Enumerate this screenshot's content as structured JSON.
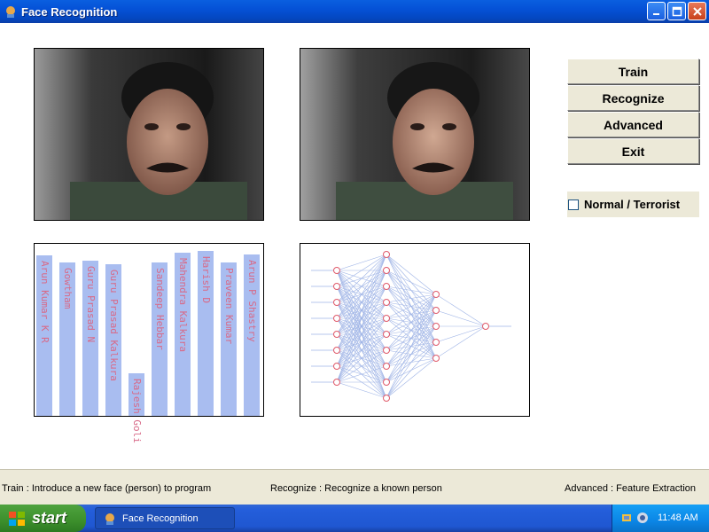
{
  "window": {
    "title": "Face Recognition"
  },
  "buttons": {
    "train": "Train",
    "recognize": "Recognize",
    "advanced": "Advanced",
    "exit": "Exit"
  },
  "checkbox": {
    "label": "Normal / Terrorist",
    "checked": false
  },
  "chart_data": {
    "type": "bar",
    "categories": [
      "Arun Kumar K R",
      "Gowtham",
      "Guru Prasad N",
      "Guru Prasad Kalkura",
      "Rajesh Goli",
      "Sandeep Hebbar",
      "Mahendra Kalkura",
      "Harish D",
      "Praveen Kumar",
      "Arun P Shastry"
    ],
    "values": [
      0.95,
      0.91,
      0.92,
      0.9,
      0.25,
      0.91,
      0.97,
      0.98,
      0.91,
      0.96
    ],
    "ylim": [
      0,
      1
    ]
  },
  "network": {
    "layers": [
      8,
      10,
      5,
      1
    ]
  },
  "status": {
    "train_help": "Train : Introduce a new face (person) to program",
    "recognize_help": "Recognize : Recognize a known person",
    "advanced_help": "Advanced : Feature Extraction"
  },
  "taskbar": {
    "start_label": "start",
    "task_title": "Face Recognition",
    "clock": "11:48 AM"
  },
  "colors": {
    "bar": "#a9bdf0",
    "bar_label": "#d86a88",
    "net_node": "#e05a6a",
    "net_edge": "#9fb4e6"
  }
}
